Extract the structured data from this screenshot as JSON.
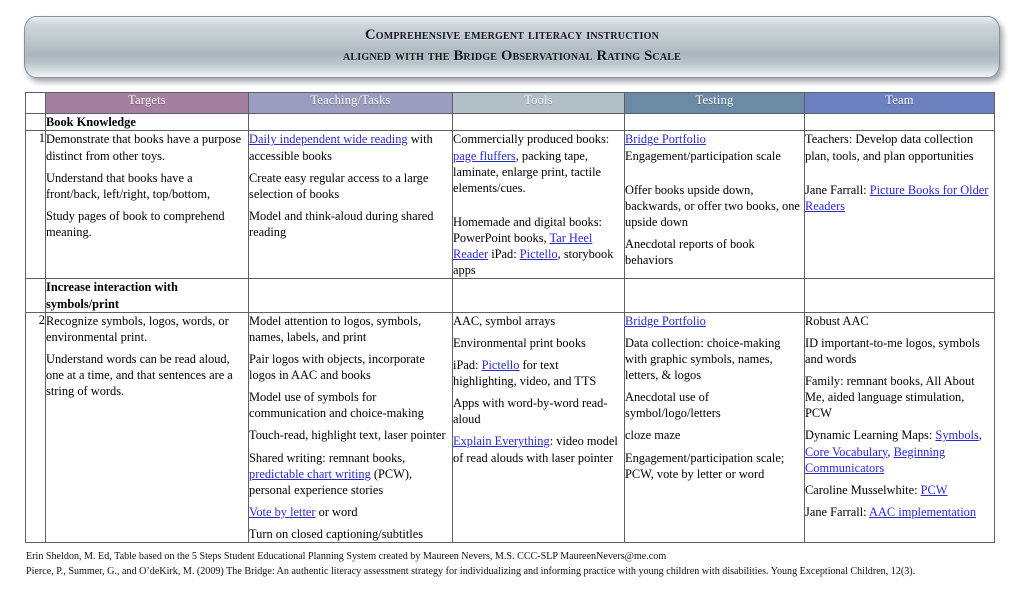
{
  "banner": {
    "line1": "Comprehensive emergent literacy instruction",
    "line2": "aligned with the Bridge Observational Rating Scale"
  },
  "colors": {
    "header_targets": "#a57fa0",
    "header_teaching": "#9b9dc0",
    "header_tools": "#b2bfc7",
    "header_testing": "#6b8ba4",
    "header_team": "#6d80bf",
    "link": "#2a2ad0",
    "grid": "#5b5f66"
  },
  "table": {
    "columns": [
      "",
      "Targets",
      "Teaching/Tasks",
      "Tools",
      "Testing",
      "Team"
    ],
    "groups": [
      {
        "label": "Book Knowledge",
        "rows": [
          {
            "number": "1",
            "targets": [
              [
                {
                  "t": "Demonstrate that books have a purpose distinct from other toys."
                }
              ],
              [
                {
                  "t": "Understand that books have a front/back, left/right, top/bottom,"
                }
              ],
              [
                {
                  "t": "Study pages of book to comprehend meaning."
                }
              ]
            ],
            "teaching": [
              [
                {
                  "t": "Daily independent wide reading",
                  "link": true
                },
                {
                  "t": " with accessible books"
                }
              ],
              [
                {
                  "t": "Create easy regular access to a large selection of books"
                }
              ],
              [
                {
                  "t": "Model and think-aloud during shared reading"
                }
              ]
            ],
            "tools": [
              [
                {
                  "t": "Commercially produced books: "
                },
                {
                  "t": "page fluffers",
                  "link": true
                },
                {
                  "t": ", packing tape, laminate, enlarge print, tactile elements/cues."
                }
              ],
              [
                {
                  "t": "Homemade and digital books: PowerPoint books, "
                },
                {
                  "t": "Tar Heel Reader",
                  "link": true
                },
                {
                  "t": " iPad: "
                },
                {
                  "t": "Pictello",
                  "link": true
                },
                {
                  "t": ", storybook apps"
                }
              ]
            ],
            "tools_gap_after": 0,
            "testing": [
              [
                {
                  "t": "Bridge Portfolio",
                  "link": true
                },
                {
                  "t": " Engagement/participation scale"
                }
              ],
              [
                {
                  "t": "Offer books upside down, backwards, or offer two books, one upside down"
                }
              ],
              [
                {
                  "t": "Anecdotal reports of book behaviors"
                }
              ]
            ],
            "testing_gap_after": 0,
            "team": [
              [
                {
                  "t": "Teachers: Develop data collection plan, tools, and plan opportunities"
                }
              ],
              [
                {
                  "t": "Jane Farrall: "
                },
                {
                  "t": "Picture Books for Older Readers",
                  "link": true
                }
              ]
            ],
            "team_gap_after": 0
          }
        ]
      },
      {
        "label": "Increase interaction with symbols/print",
        "rows": [
          {
            "number": "2",
            "targets": [
              [
                {
                  "t": "Recognize symbols, logos, words, or environmental print."
                }
              ],
              [
                {
                  "t": "Understand words can be read aloud, one at a time, and that sentences are a string of words."
                }
              ]
            ],
            "teaching": [
              [
                {
                  "t": "Model attention to logos, symbols, names, labels, and print"
                }
              ],
              [
                {
                  "t": "Pair logos with objects, incorporate logos in AAC and books"
                }
              ],
              [
                {
                  "t": "Model use of symbols for communication and choice-making"
                }
              ],
              [
                {
                  "t": "Touch-read, highlight text, laser pointer"
                }
              ],
              [
                {
                  "t": "Shared writing: remnant books, "
                },
                {
                  "t": "predictable chart writing",
                  "link": true
                },
                {
                  "t": " (PCW), personal experience stories"
                }
              ],
              [
                {
                  "t": "Vote by letter",
                  "link": true
                },
                {
                  "t": " or word"
                }
              ],
              [
                {
                  "t": "Turn on closed captioning/subtitles"
                }
              ]
            ],
            "tools": [
              [
                {
                  "t": "AAC, symbol arrays"
                }
              ],
              [
                {
                  "t": "Environmental print books"
                }
              ],
              [
                {
                  "t": "iPad: "
                },
                {
                  "t": "Pictello",
                  "link": true
                },
                {
                  "t": " for text highlighting, video, and TTS"
                }
              ],
              [
                {
                  "t": "Apps with word-by-word read-aloud"
                }
              ],
              [
                {
                  "t": "Explain Everything",
                  "link": true
                },
                {
                  "t": ": video model of read alouds with laser pointer"
                }
              ]
            ],
            "testing": [
              [
                {
                  "t": "Bridge Portfolio",
                  "link": true
                }
              ],
              [
                {
                  "t": "Data collection: choice-making with graphic symbols, names, letters, & logos"
                }
              ],
              [
                {
                  "t": "Anecdotal use of symbol/logo/letters"
                }
              ],
              [
                {
                  "t": "cloze maze"
                }
              ],
              [
                {
                  "t": "Engagement/participation scale; PCW, vote by letter or word"
                }
              ]
            ],
            "team": [
              [
                {
                  "t": "Robust AAC"
                }
              ],
              [
                {
                  "t": "ID important-to-me logos, symbols and words"
                }
              ],
              [
                {
                  "t": "Family: remnant books, All About Me, aided language stimulation, PCW"
                }
              ],
              [
                {
                  "t": "Dynamic Learning Maps: "
                },
                {
                  "t": "Symbols",
                  "link": true
                },
                {
                  "t": ", "
                },
                {
                  "t": "Core  Vocabulary",
                  "link": true
                },
                {
                  "t": ", "
                },
                {
                  "t": "Beginning Communicators",
                  "link": true
                }
              ],
              [
                {
                  "t": "Caroline Musselwhite: "
                },
                {
                  "t": "PCW",
                  "link": true
                }
              ],
              [
                {
                  "t": "Jane Farrall: "
                },
                {
                  "t": "AAC implementation",
                  "link": true
                }
              ]
            ]
          }
        ]
      }
    ]
  },
  "footer": {
    "line1": "Erin Sheldon, M. Ed, Table based on the 5 Steps Student Educational Planning System created by Maureen Nevers, M.S. CCC-SLP MaureenNevers@me.com",
    "line2": "Pierce,  P., Summer, G., and O’deKirk, M. (2009) The Bridge: An authentic literacy assessment strategy for individualizing and informing practice with young children with disabilities. Young Exceptional Children, 12(3)."
  }
}
